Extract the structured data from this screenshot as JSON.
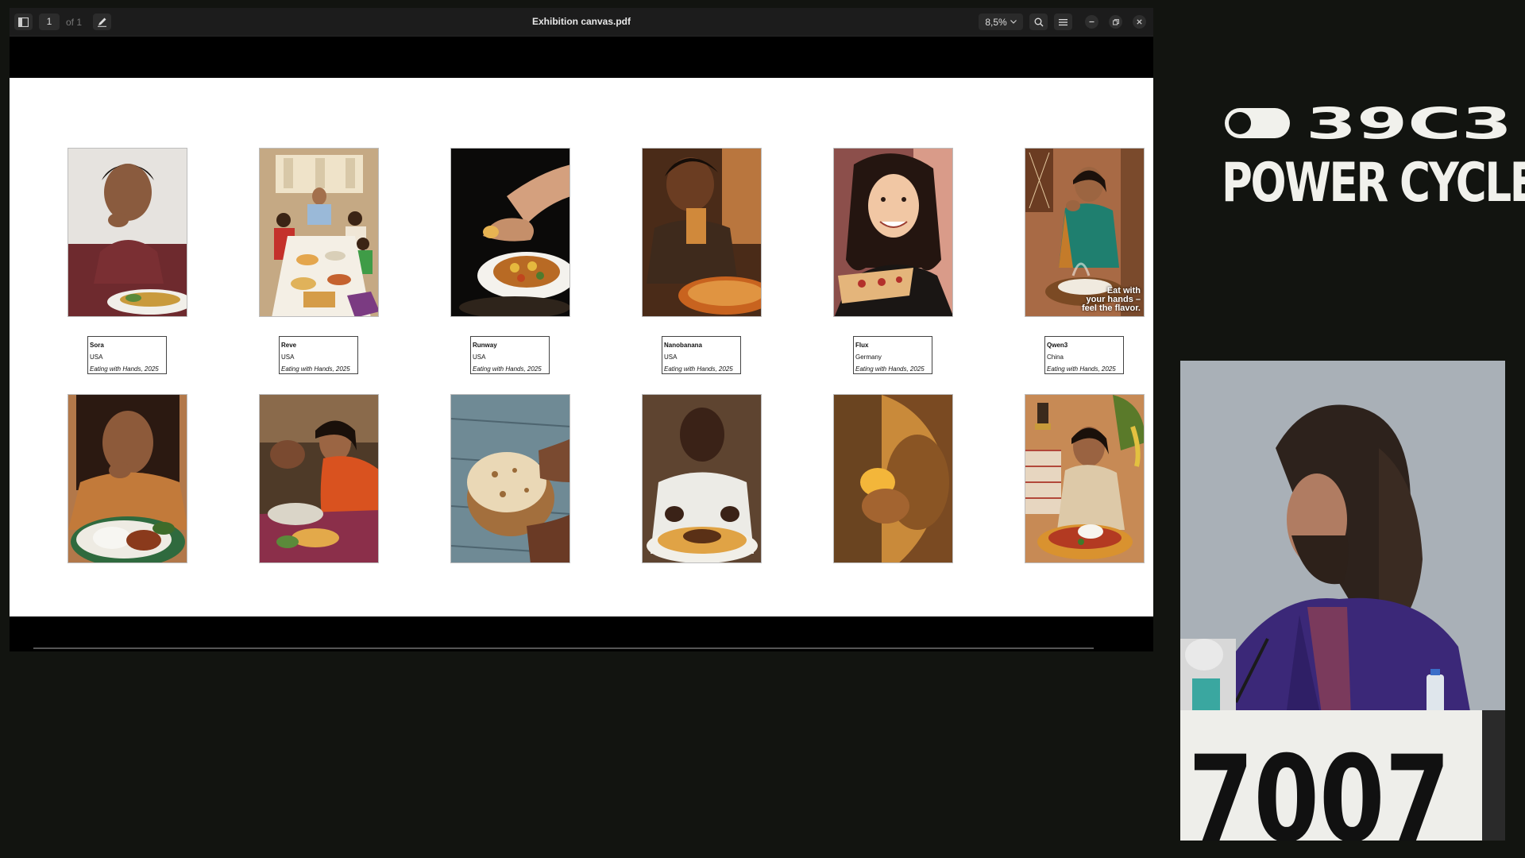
{
  "viewer": {
    "page_current": "1",
    "page_total": "of 1",
    "doc_title": "Exhibition canvas.pdf",
    "zoom": "8,5%",
    "icons": [
      "sidebar-icon",
      "pen-icon",
      "chevron-down-icon",
      "search-icon",
      "menu-icon",
      "minimize-icon",
      "restore-icon",
      "close-icon"
    ]
  },
  "gallery": {
    "row1": [
      {
        "model": "Sora",
        "country": "USA",
        "title": "Eating with Hands, 2025"
      },
      {
        "model": "Reve",
        "country": "USA",
        "title": "Eating with Hands, 2025"
      },
      {
        "model": "Runway",
        "country": "USA",
        "title": "Eating with Hands, 2025"
      },
      {
        "model": "Nanobanana",
        "country": "USA",
        "title": "Eating with Hands, 2025"
      },
      {
        "model": "Flux",
        "country": "Germany",
        "title": "Eating with Hands, 2025"
      },
      {
        "model": "Qwen3",
        "country": "China",
        "title": "Eating with Hands, 2025"
      }
    ],
    "qwen_image_text": [
      "Eat with",
      "your hands –",
      "feel the flavor."
    ]
  },
  "brand": {
    "number": "39C3",
    "title": "POWER CYCLES"
  },
  "podium": {
    "sign": "7007"
  },
  "colors": {
    "background": "#121410",
    "brand_text": "#f1f1ec",
    "speaker_suit": "#3b2878"
  }
}
